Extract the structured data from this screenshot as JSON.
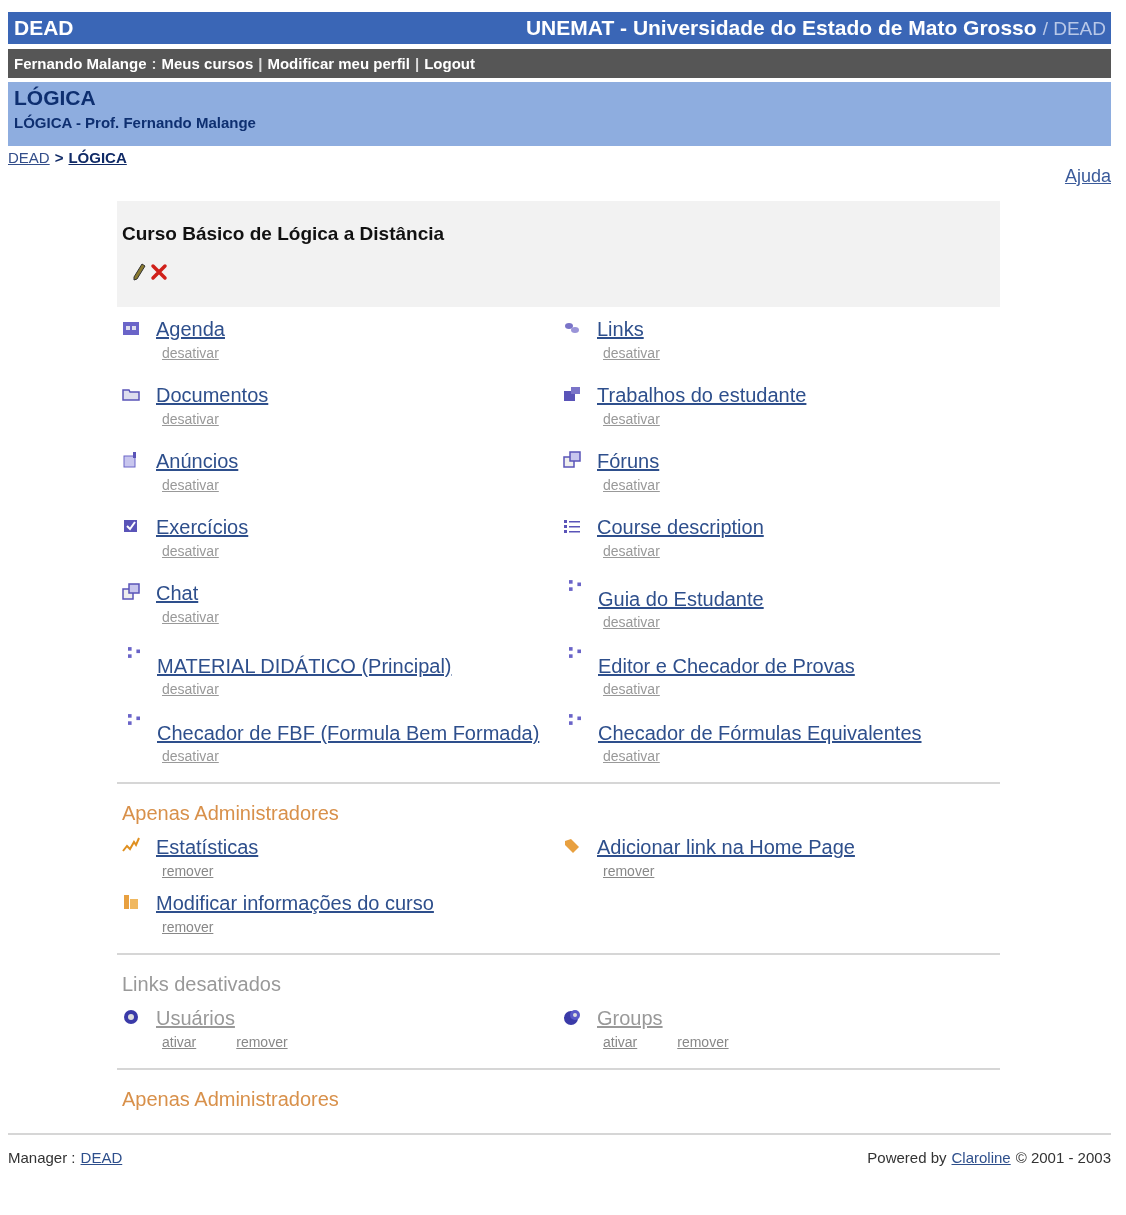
{
  "header": {
    "site": "DEAD",
    "institution": "UNEMAT - Universidade do Estado de Mato Grosso",
    "suffix": "/ DEAD"
  },
  "user_bar": [
    {
      "label": "Fernando Malange",
      "sep": ":"
    },
    {
      "label": "Meus cursos",
      "sep": "|"
    },
    {
      "label": "Modificar meu perfil",
      "sep": "|"
    },
    {
      "label": "Logout"
    }
  ],
  "course": {
    "title": "LÓGICA",
    "subtitle": "LÓGICA - Prof. Fernando Malange"
  },
  "breadcrumb": [
    {
      "label": "DEAD",
      "current": false
    },
    {
      "label": "LÓGICA",
      "current": true
    }
  ],
  "breadcrumb_sep": ">",
  "help": "Ajuda",
  "intro": {
    "title": "Curso Básico de Lógica a Distância"
  },
  "tools": [
    {
      "label": "Agenda",
      "kind": "calendar",
      "action": "desativar"
    },
    {
      "label": "Links",
      "kind": "link",
      "action": "desativar"
    },
    {
      "label": "Documentos",
      "kind": "folder",
      "action": "desativar"
    },
    {
      "label": "Trabalhos do estudante",
      "kind": "group",
      "action": "desativar"
    },
    {
      "label": "Anúncios",
      "kind": "note",
      "action": "desativar"
    },
    {
      "label": "Fóruns",
      "kind": "forum",
      "action": "desativar"
    },
    {
      "label": "Exercícios",
      "kind": "checkbox",
      "action": "desativar"
    },
    {
      "label": "Course description",
      "kind": "list",
      "action": "desativar"
    },
    {
      "label": "Chat",
      "kind": "forum",
      "action": "desativar"
    },
    {
      "label": "Guia do Estudante",
      "kind": "dots",
      "action": "desativar"
    },
    {
      "label": "MATERIAL DIDÁTICO (Principal)",
      "kind": "dots",
      "action": "desativar"
    },
    {
      "label": "Editor e Checador de Provas",
      "kind": "dots",
      "action": "desativar"
    },
    {
      "label": "Checador de FBF (Formula Bem Formada)",
      "kind": "dots",
      "action": "desativar"
    },
    {
      "label": "Checador de Fórmulas Equivalentes",
      "kind": "dots",
      "action": "desativar"
    }
  ],
  "sections": [
    {
      "title": "Apenas Administradores",
      "kind": "admin",
      "items": [
        {
          "label": "Estatísticas",
          "kind": "chart",
          "actions": [
            "remover"
          ]
        },
        {
          "label": "Adicionar link na Home Page",
          "kind": "tag",
          "actions": [
            "remover"
          ]
        },
        {
          "label": "Modificar informações do curso",
          "kind": "books",
          "actions": [
            "remover"
          ]
        }
      ]
    },
    {
      "title": "Links desativados",
      "kind": "disabled",
      "items": [
        {
          "label": "Usuários",
          "kind": "user",
          "actions": [
            "ativar",
            "remover"
          ]
        },
        {
          "label": "Groups",
          "kind": "users",
          "actions": [
            "ativar",
            "remover"
          ]
        }
      ]
    },
    {
      "title": "Apenas Administradores",
      "kind": "admin"
    }
  ],
  "footer": {
    "manager_label": "Manager :",
    "manager_link": "DEAD",
    "powered": "Powered by",
    "powered_link": "Claroline",
    "copyright": "© 2001 - 2003"
  }
}
